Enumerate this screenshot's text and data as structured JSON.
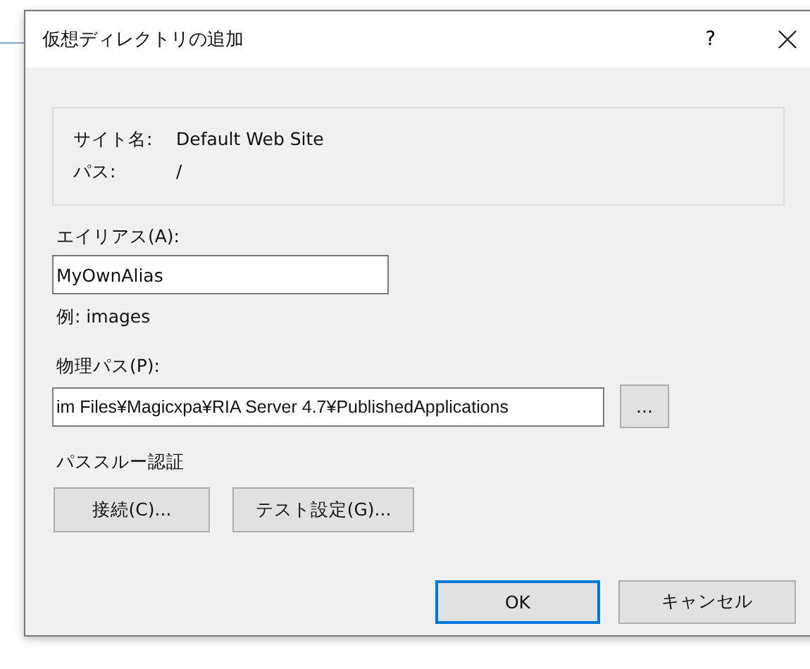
{
  "window": {
    "title": "仮想ディレクトリの追加",
    "help_button": "?"
  },
  "site_info": [
    {
      "label": "サイト名:",
      "value": "Default Web Site"
    },
    {
      "label": "パス:",
      "value": "/"
    }
  ],
  "alias": {
    "label": "エイリアス(A):",
    "value": "MyOwnAlias",
    "example": "例: images"
  },
  "physical_path": {
    "label": "物理パス(P):",
    "value": "im Files¥Magicxpa¥RIA Server 4.7¥PublishedApplications",
    "browse_button": "..."
  },
  "pass_through": {
    "label": "パススルー認証",
    "buttons": [
      "接続(C)...",
      "テスト設定(G)..."
    ]
  },
  "buttons": [
    {
      "label": "OK",
      "default": true
    },
    {
      "label": "キャンセル",
      "default": false
    }
  ]
}
